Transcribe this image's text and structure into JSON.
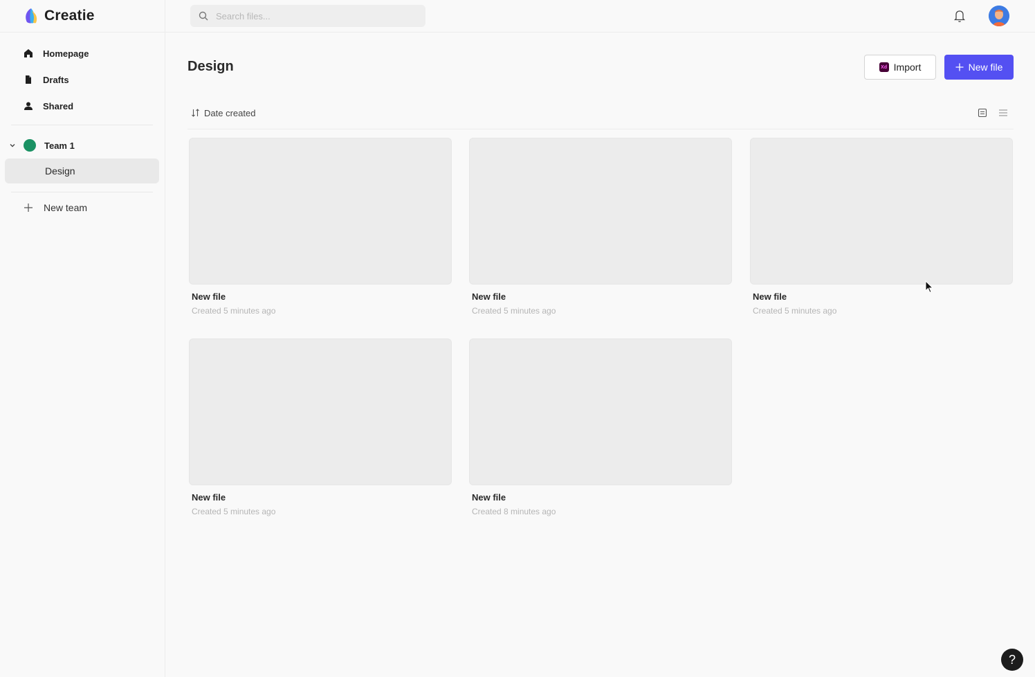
{
  "app": {
    "name": "Creatie"
  },
  "search": {
    "placeholder": "Search files..."
  },
  "sidebar": {
    "items": [
      {
        "label": "Homepage",
        "icon": "home-icon"
      },
      {
        "label": "Drafts",
        "icon": "file-icon"
      },
      {
        "label": "Shared",
        "icon": "user-icon"
      }
    ],
    "team": {
      "name": "Team 1",
      "color": "#1a9163",
      "projects": [
        "Design"
      ]
    },
    "new_team_label": "New team"
  },
  "main": {
    "title": "Design",
    "import_label": "Import",
    "import_icon_text": "Xd",
    "new_file_label": "New file",
    "sort_label": "Date created",
    "files": [
      {
        "name": "New file",
        "meta": "Created 5 minutes ago"
      },
      {
        "name": "New file",
        "meta": "Created 5 minutes ago"
      },
      {
        "name": "New file",
        "meta": "Created 5 minutes ago"
      },
      {
        "name": "New file",
        "meta": "Created 5 minutes ago"
      },
      {
        "name": "New file",
        "meta": "Created 8 minutes ago"
      }
    ]
  },
  "help": {
    "label": "?"
  },
  "colors": {
    "accent": "#5450f2",
    "team": "#1a9163"
  }
}
